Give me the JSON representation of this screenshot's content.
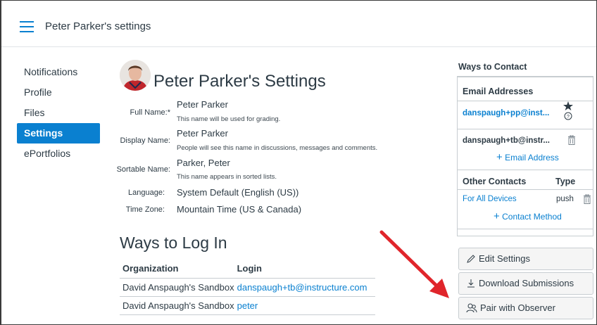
{
  "header": {
    "title": "Peter Parker's settings"
  },
  "nav": {
    "items": [
      {
        "label": "Notifications"
      },
      {
        "label": "Profile"
      },
      {
        "label": "Files"
      },
      {
        "label": "Settings"
      },
      {
        "label": "ePortfolios"
      }
    ]
  },
  "profile": {
    "title": "Peter Parker's Settings",
    "full_name_label": "Full Name:*",
    "full_name": "Peter Parker",
    "full_name_hint": "This name will be used for grading.",
    "display_name_label": "Display Name:",
    "display_name": "Peter Parker",
    "display_name_hint": "People will see this name in discussions, messages and comments.",
    "sortable_name_label": "Sortable Name:",
    "sortable_name": "Parker, Peter",
    "sortable_name_hint": "This name appears in sorted lists.",
    "language_label": "Language:",
    "language": "System Default (English (US))",
    "timezone_label": "Time Zone:",
    "timezone": "Mountain Time (US & Canada)"
  },
  "logins": {
    "heading": "Ways to Log In",
    "columns": [
      "Organization",
      "Login"
    ],
    "rows": [
      {
        "organization": "David Anspaugh's Sandbox",
        "login": "danspaugh+tb@instructure.com"
      },
      {
        "organization": "David Anspaugh's Sandbox",
        "login": "peter"
      }
    ]
  },
  "contact": {
    "title": "Ways to Contact",
    "email_heading": "Email Addresses",
    "emails": [
      {
        "address": "danspaugh+pp@inst..."
      },
      {
        "address": "danspaugh+tb@instr..."
      }
    ],
    "add_email": "Email Address",
    "other_heading": "Other Contacts",
    "type_heading": "Type",
    "other": [
      {
        "name": "For All Devices",
        "type": "push"
      }
    ],
    "add_contact": "Contact Method"
  },
  "actions": {
    "edit": "Edit Settings",
    "download": "Download Submissions",
    "observer": "Pair with Observer"
  },
  "colors": {
    "accent": "#0a80d0",
    "arrow": "#e0252b"
  }
}
